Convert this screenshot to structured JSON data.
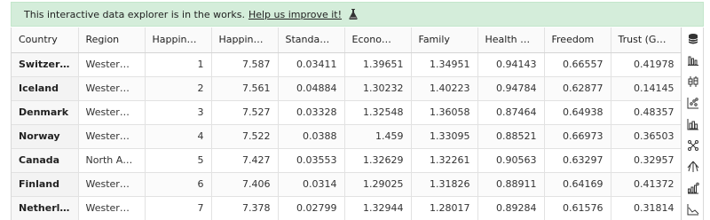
{
  "banner": {
    "text": "This interactive data explorer is in the works.",
    "link": "Help us improve it!"
  },
  "table": {
    "columns": [
      "Country",
      "Region",
      "Happin…",
      "Happin…",
      "Standa…",
      "Econo…",
      "Family",
      "Health …",
      "Freedom",
      "Trust (G…"
    ],
    "rows": [
      [
        "Switzer…",
        "Wester…",
        "1",
        "7.587",
        "0.03411",
        "1.39651",
        "1.34951",
        "0.94143",
        "0.66557",
        "0.41978"
      ],
      [
        "Iceland",
        "Wester…",
        "2",
        "7.561",
        "0.04884",
        "1.30232",
        "1.40223",
        "0.94784",
        "0.62877",
        "0.14145"
      ],
      [
        "Denmark",
        "Wester…",
        "3",
        "7.527",
        "0.03328",
        "1.32548",
        "1.36058",
        "0.87464",
        "0.64938",
        "0.48357"
      ],
      [
        "Norway",
        "Wester…",
        "4",
        "7.522",
        "0.0388",
        "1.459",
        "1.33095",
        "0.88521",
        "0.66973",
        "0.36503"
      ],
      [
        "Canada",
        "North A…",
        "5",
        "7.427",
        "0.03553",
        "1.32629",
        "1.32261",
        "0.90563",
        "0.63297",
        "0.32957"
      ],
      [
        "Finland",
        "Wester…",
        "6",
        "7.406",
        "0.0314",
        "1.29025",
        "1.31826",
        "0.88911",
        "0.64169",
        "0.41372"
      ],
      [
        "Netherl…",
        "Wester…",
        "7",
        "7.378",
        "0.02799",
        "1.32944",
        "1.28017",
        "0.89284",
        "0.61576",
        "0.31814"
      ]
    ]
  },
  "sidebar": {
    "tools": [
      "database-icon",
      "bar-chart-icon",
      "box-plot-icon",
      "scatter-icon",
      "histogram-icon",
      "network-icon",
      "tree-icon",
      "parallel-icon",
      "line-chart-icon"
    ]
  }
}
